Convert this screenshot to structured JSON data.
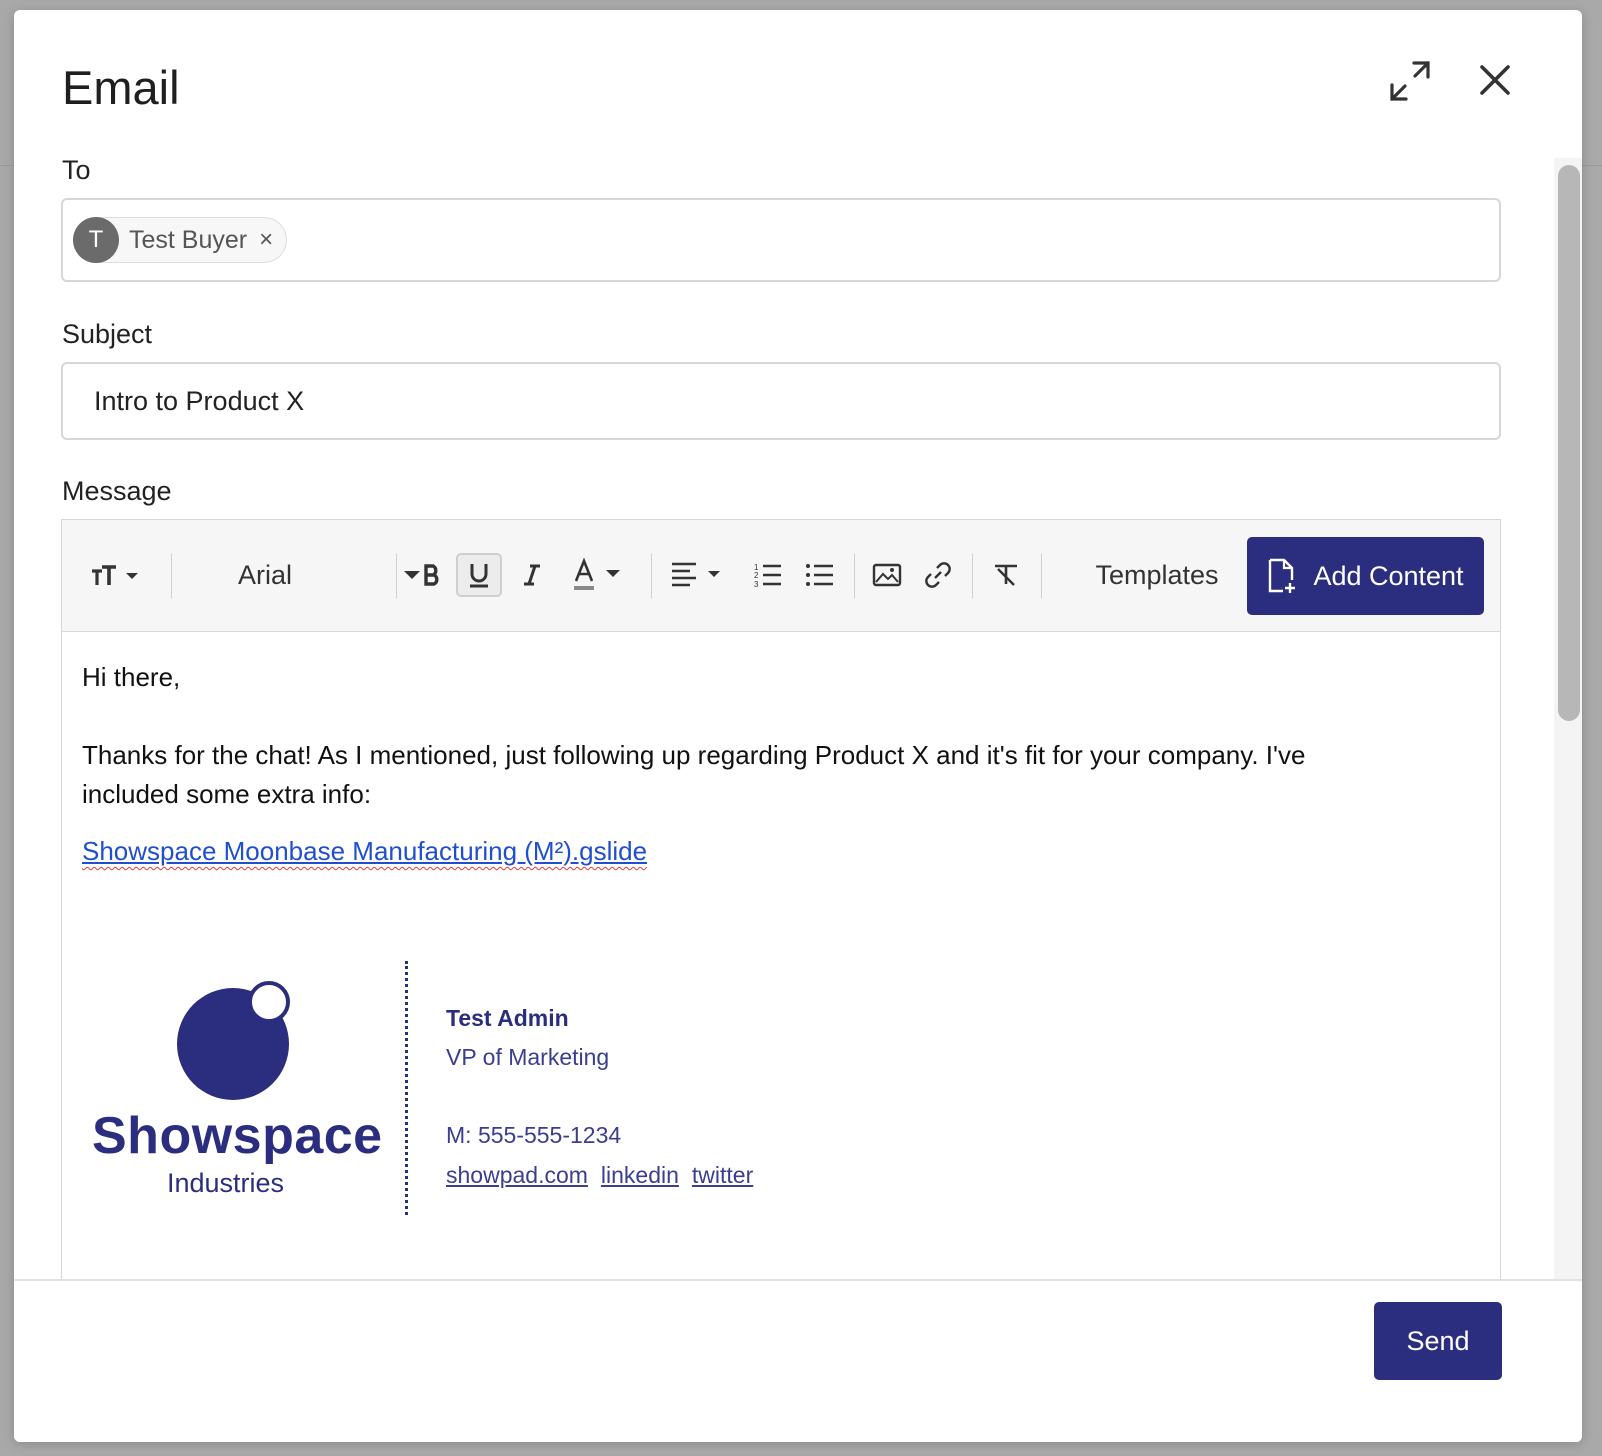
{
  "modal": {
    "title": "Email"
  },
  "to": {
    "label": "To",
    "recipients": [
      {
        "initial": "T",
        "name": "Test Buyer",
        "remove": "×"
      }
    ]
  },
  "subject": {
    "label": "Subject",
    "value": "Intro to Product X"
  },
  "message": {
    "label": "Message",
    "toolbar": {
      "font_family": "Arial",
      "templates_label": "Templates",
      "add_content_label": "Add Content"
    },
    "greeting": "Hi there,",
    "paragraph_line1": "Thanks for the chat! As I mentioned, just following up regarding Product X and it's fit for your company. I've",
    "paragraph_line2": "included some extra info:",
    "link_text": "Showspace Moonbase Manufacturing (M²).gslide",
    "signature": {
      "logo_name": "Showspace",
      "logo_sub": "Industries",
      "name": "Test Admin",
      "title": "VP of Marketing",
      "phone": "M: 555-555-1234",
      "links": [
        "showpad.com",
        "linkedin",
        "twitter"
      ]
    }
  },
  "footer": {
    "send_label": "Send"
  },
  "colors": {
    "accent": "#2b2d7f",
    "link": "#1f4fcf"
  }
}
